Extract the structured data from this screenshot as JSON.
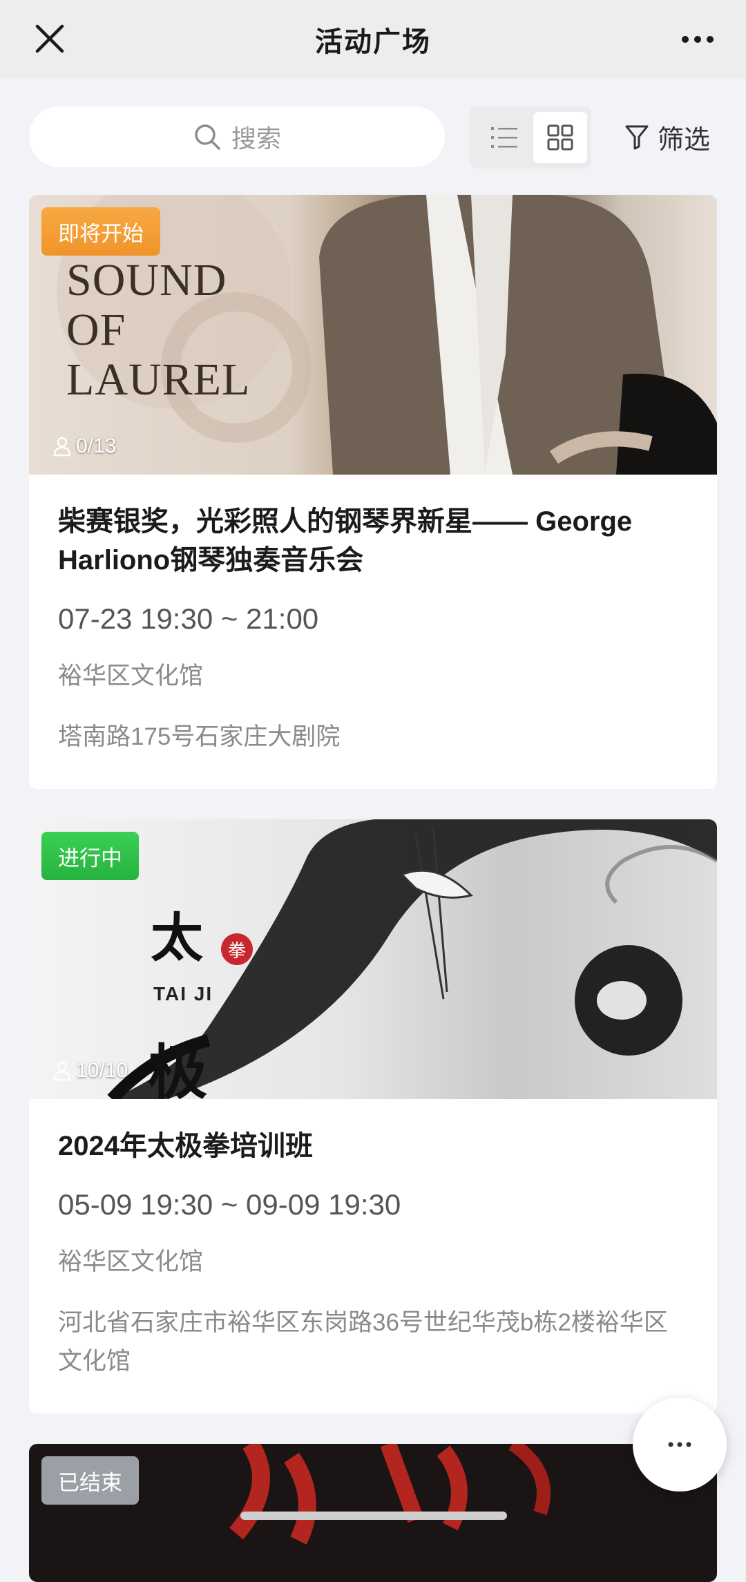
{
  "navbar": {
    "title": "活动广场"
  },
  "toolbar": {
    "search_placeholder": "搜索",
    "filter_label": "筛选"
  },
  "events": [
    {
      "status": "即将开始",
      "status_color": "#f5a033",
      "capacity": "0/13",
      "title": "柴赛银奖，光彩照人的钢琴界新星—— George Harliono钢琴独奏音乐会",
      "time": "07-23 19:30 ~ 21:00",
      "organizer": "裕华区文化馆",
      "address": "塔南路175号石家庄大剧院",
      "cover_text": [
        "SOUND",
        "OF",
        "LAUREL"
      ]
    },
    {
      "status": "进行中",
      "status_color": "#2fbf4a",
      "capacity": "10/10",
      "title": "2024年太极拳培训班",
      "time": "05-09 19:30 ~ 09-09 19:30",
      "organizer": "裕华区文化馆",
      "address": "河北省石家庄市裕华区东岗路36号世纪华茂b栋2楼裕华区文化馆",
      "cover_text": [
        "太",
        "拳",
        "TAI JI",
        "极"
      ]
    },
    {
      "status": "已结束",
      "status_color": "#9aa0a6"
    }
  ]
}
